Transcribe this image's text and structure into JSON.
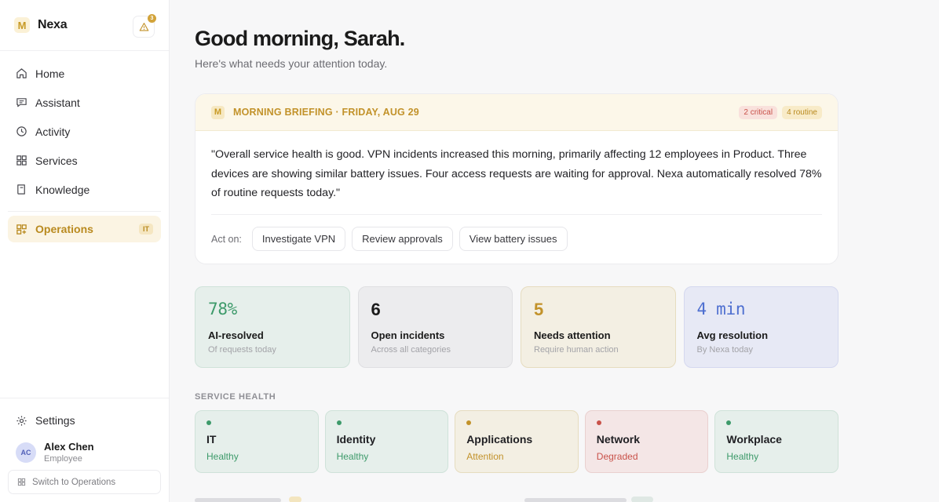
{
  "app": {
    "logo_letter": "M",
    "name": "Nexa",
    "alert_count": "3"
  },
  "nav": {
    "items": [
      {
        "label": "Home",
        "icon": "home-icon"
      },
      {
        "label": "Assistant",
        "icon": "chat-icon"
      },
      {
        "label": "Activity",
        "icon": "clock-icon"
      },
      {
        "label": "Services",
        "icon": "grid-icon"
      },
      {
        "label": "Knowledge",
        "icon": "book-icon"
      }
    ],
    "active": {
      "label": "Operations",
      "tag": "IT",
      "icon": "operations-icon"
    }
  },
  "sidebar_bottom": {
    "settings_label": "Settings",
    "user": {
      "initials": "AC",
      "name": "Alex Chen",
      "role": "Employee"
    },
    "switch_label": "Switch to Operations"
  },
  "header": {
    "greeting": "Good morning, Sarah.",
    "subtitle": "Here's what needs your attention today."
  },
  "briefing": {
    "mark": "M",
    "title": "MORNING BRIEFING · FRIDAY, AUG 29",
    "badge_critical": "2 critical",
    "badge_routine": "4 routine",
    "quote": "\"Overall service health is good. VPN incidents increased this morning, primarily affecting 12 employees in Product. Three devices are showing similar battery issues. Four access requests are waiting for approval. Nexa automatically resolved 78% of routine requests today.\"",
    "act_label": "Act on:",
    "actions": [
      "Investigate VPN",
      "Review approvals",
      "View battery issues"
    ]
  },
  "stats": [
    {
      "value": "78%",
      "title": "AI-resolved",
      "sub": "Of requests today"
    },
    {
      "value": "6",
      "title": "Open incidents",
      "sub": "Across all categories"
    },
    {
      "value": "5",
      "title": "Needs attention",
      "sub": "Require human action"
    },
    {
      "value": "4 min",
      "title": "Avg resolution",
      "sub": "By Nexa today"
    }
  ],
  "service_health": {
    "label": "SERVICE HEALTH",
    "items": [
      {
        "name": "IT",
        "status": "Healthy"
      },
      {
        "name": "Identity",
        "status": "Healthy"
      },
      {
        "name": "Applications",
        "status": "Attention"
      },
      {
        "name": "Network",
        "status": "Degraded"
      },
      {
        "name": "Workplace",
        "status": "Healthy"
      }
    ]
  },
  "colors": {
    "accent": "#c2922a",
    "healthy": "#3d9a6a",
    "degraded": "#c9524a",
    "info": "#4e6fd0"
  }
}
